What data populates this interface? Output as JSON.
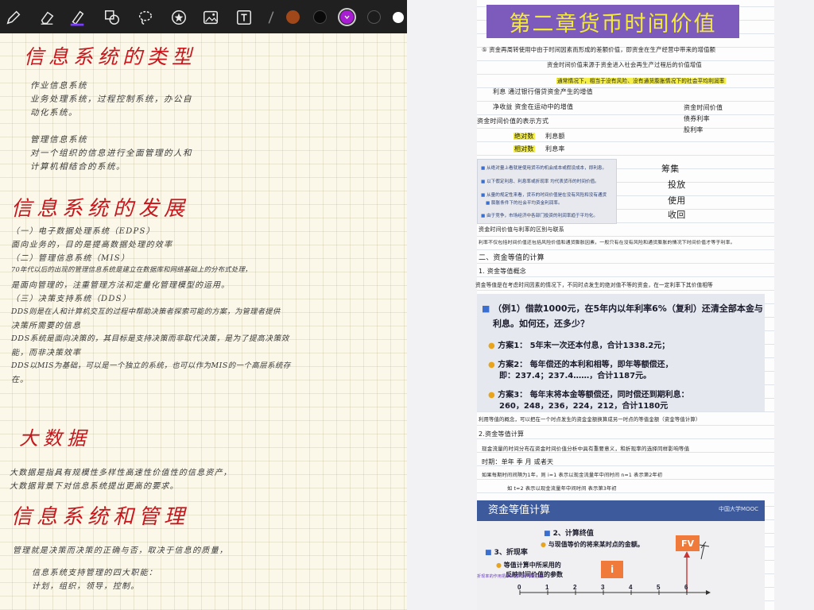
{
  "toolbar": {
    "tools": [
      "pencil-icon",
      "eraser-icon",
      "highlighter-icon",
      "shapes-icon",
      "lasso-icon",
      "sticker-icon",
      "image-icon",
      "text-box-icon",
      "more-tools-icon"
    ],
    "swatches": [
      {
        "name": "brown",
        "color": "#a0481a"
      },
      {
        "name": "black",
        "color": "#0a0a0a"
      },
      {
        "name": "purple",
        "color": "#a81cd2"
      }
    ]
  },
  "left_notes": {
    "h_types": "信息系统的类型",
    "types_line1": "作业信息系统",
    "types_line2": "业务处理系统，过程控制系统，办公自",
    "types_line3": "动化系统。",
    "types_line4": "管理信息系统",
    "types_line5": "对一个组织的信息进行全面管理的人和",
    "types_line6": "计算机相结合的系统。",
    "h_dev": "信息系统的发展",
    "dev_line1": "（一）电子数据处理系统（EDPS）",
    "dev_line2": "面向业务的，目的是提高数据处理的效率",
    "dev_line3": "（二）管理信息系统（MIS）",
    "dev_line4": "70年代以后的出现的管理信息系统是建立在数据库和网络基础上的分布式处理，",
    "dev_line5": "是面向管理的，注重管理方法和定量化管理模型的运用。",
    "dev_line6": "（三）决策支持系统（DDS）",
    "dev_line7": "DDS则是在人和计算机交互的过程中帮助决策者探索可能的方案，为管理者提供",
    "dev_line8": "决策所需要的信息",
    "dev_line9": "DDS系统是面向决策的，其目标是支持决策而非取代决策，是为了提高决策效",
    "dev_line10": "能，而非决策效率",
    "dev_line11": "DDS以MIS为基础，可以是一个独立的系统，也可以作为MIS的一个高层系统存",
    "dev_line12": "在。",
    "h_bigdata": "大数据",
    "bd_line1": "大数据是指具有规模性多样性高速性价值性的信息资产，",
    "bd_line2": "大数据背景下对信息系统提出更高的要求。",
    "h_mgmt": "信息系统和管理",
    "mg_line1": "管理就是决策而决策的正确与否，取决于信息的质量，",
    "mg_line2": "信息系统支持管理的四大职能：",
    "mg_line3": "计划，组织，领导，控制。"
  },
  "right_notes": {
    "chapter_title": "第二章货币时间价值",
    "n1": "⑤ 资金再周转使用中由于时间因素而形成的差额价值，即资金在生产经营中带来的增值额",
    "n2": "资金时间价值来源于资金进入社会再生产过程后的价值增值",
    "n3": "通常情况下，相当于没有风险、没有通货膨胀情况下的社会平均利润率",
    "n4": "利息 通过银行借贷资金产生的增值",
    "n5": "净收益 资金在运动中的增值",
    "n6": "资金时间价值的表示方式",
    "n7": "绝对数",
    "n8": "利息额",
    "n9": "相对数",
    "n10": "利息率",
    "n11": "资金时间价值",
    "n12": "债券利率",
    "n13": "股利率",
    "box_lines": [
      "从绝对量上看就是使用货币的机会成本或假设成本，即利息。",
      "以下假定利息、利息率或折现率 均代表货币的时间价值。",
      "从量的规定性来看，货币的时间价值是在没有风险和没有通货",
      "膨胀条件下的社会平均资金利润率。",
      "由于竞争，市场经济中各部门投资的利润率趋于平均化。"
    ],
    "side1": "筹集",
    "side2": "投放",
    "side3": "使用",
    "side4": "收回",
    "n14": "资金时间价值与利率的区别与联系",
    "n15": "利率不仅包括时间价值还包括风险价值和通货膨胀因素，一般只有在没有风险和通货膨胀的情况下时间价值才等于利率。",
    "n16": "二、资金等值的计算",
    "n17": "1. 资金等值概念",
    "n18": "资金等值是在考虑时间因素的情况下，不同时点发生的绝对值不等的资金，在一定利率下其价值相等",
    "example": {
      "line1": "（例1）借款1000元，在5年内以年利率6%（复利）还清全部本金与",
      "line2": "利息。如何还，还多少？",
      "plan1": "方案1： 5年末一次还本付息，合计1338.2元；",
      "plan2a": "方案2： 每年偿还的本利和相等，即年等额偿还，",
      "plan2b": "即：237.4；237.4……，合计1187元。",
      "plan3a": "方案3： 每年末将本金等额偿还，同时偿还到期利息：",
      "plan3b": "260，248，236，224，212，合计1180元"
    },
    "n19": "利用等值的概念，可以把在一个时点发生的资金金额换算成另一时点的等值金额（资金等值计算）",
    "n20": "2.资金等值计算",
    "n21": "现金流量的时间分布在资金时间价值分析中具有重要意义，和折现率的选择同样影响等值",
    "n22": "时期：单年 季 月 或者天",
    "n23": "如果每期时间间隔为1年，则 i=1 表示以现金流量年中间时间 n=1 表示第2年初",
    "n24": "如 t=2 表示以现金流量年中间时间 表示第3年初",
    "slide": {
      "header": "资金等值计算",
      "logo": "中国大学MOOC",
      "item2": "2、计算终值",
      "item2_sub": "与现值等价的将来某时点的金额。",
      "item3": "3、折现率",
      "item3_sub1": "等值计算中所采用的",
      "item3_sub2": "反映时间价值的参数",
      "annot": "折现率的作用把未来值转换为现在值",
      "fv": "FV",
      "i_label": "i",
      "ticks": [
        "0",
        "1",
        "2",
        "3",
        "4",
        "5",
        "6"
      ]
    }
  }
}
